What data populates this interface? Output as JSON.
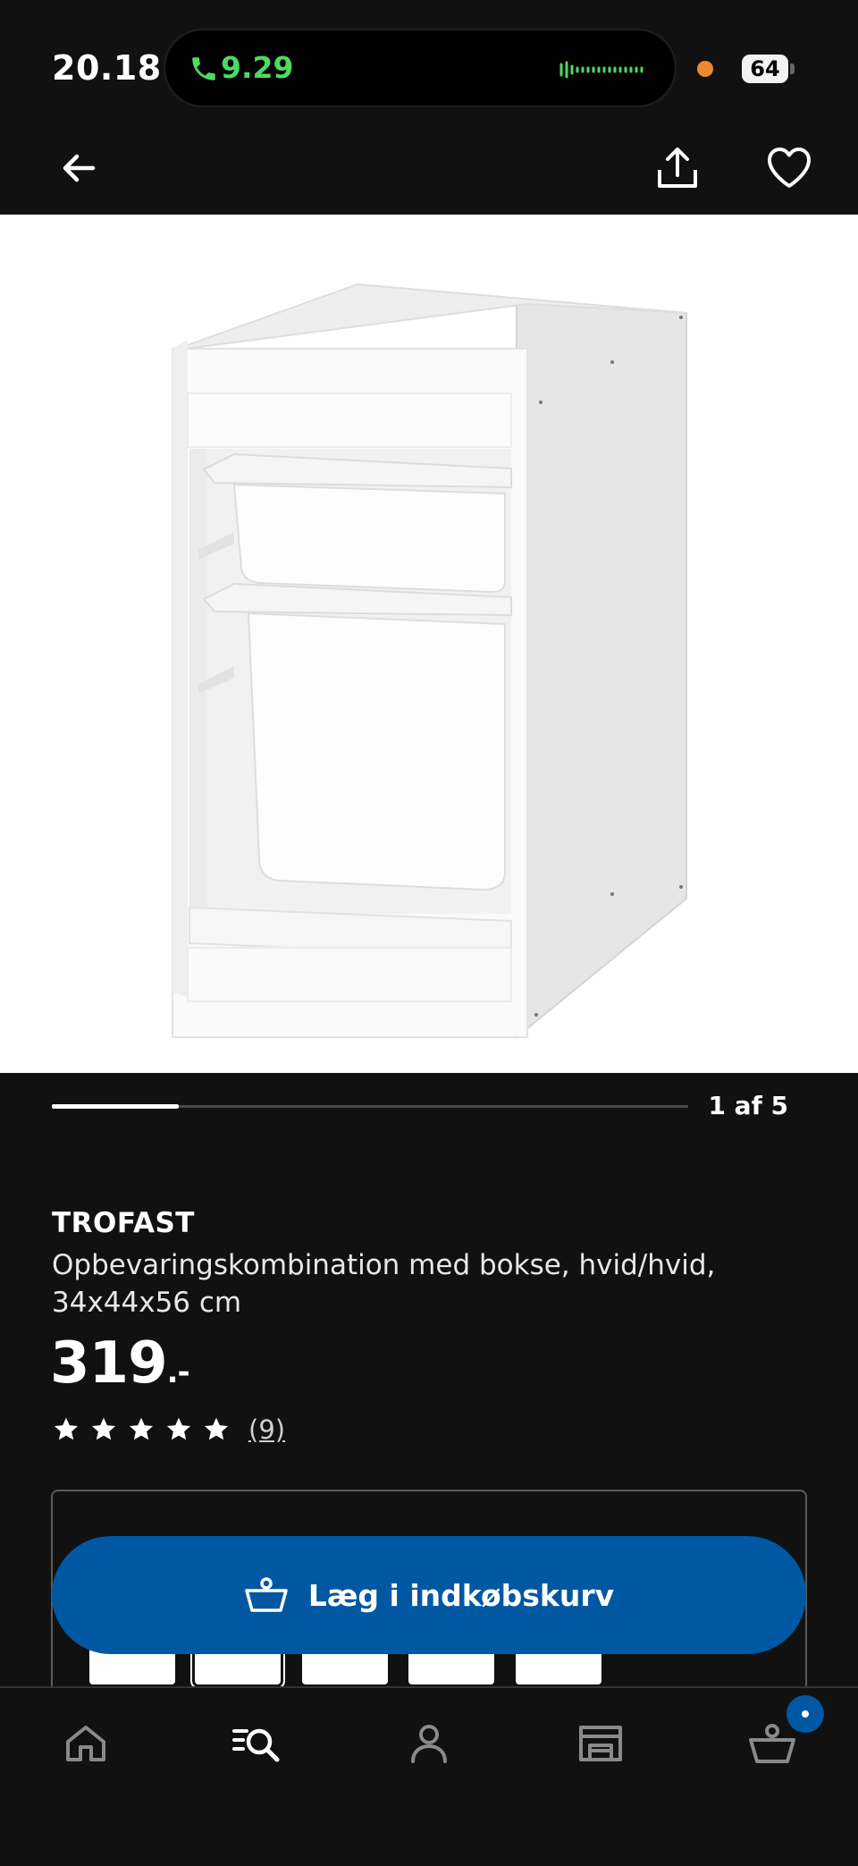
{
  "status_bar": {
    "time": "20.18",
    "call_timer": "9.29",
    "battery": "64"
  },
  "nav": {
    "back_icon": "arrow-left-icon",
    "share_icon": "share-icon",
    "favorite_icon": "heart-icon"
  },
  "gallery": {
    "position_label": "1 af 5",
    "current": 1,
    "total": 5
  },
  "product": {
    "name": "TROFAST",
    "description": "Opbevaringskombination med bokse, hvid/hvid, 34x44x56 cm",
    "price": "319",
    "price_suffix": ".-",
    "rating": 5,
    "review_count": "(9)"
  },
  "variants": {
    "thumbnails": [
      {
        "color": "#4cc48a"
      },
      {
        "color": "#e8e8e8"
      },
      {
        "color": "#8f86e0"
      },
      {
        "color": "#58c48c"
      },
      {
        "color": "#8fd0f0"
      }
    ],
    "selected_index": 1
  },
  "cart_button": {
    "label": "Læg i indkøbskurv",
    "icon": "basket-icon"
  },
  "tab_bar": {
    "items": [
      "home-icon",
      "search-icon",
      "profile-icon",
      "store-icon",
      "basket-icon"
    ],
    "active": "search-icon"
  },
  "colors": {
    "background": "#111111",
    "accent_blue": "#0058a3",
    "call_green": "#4cd964"
  }
}
